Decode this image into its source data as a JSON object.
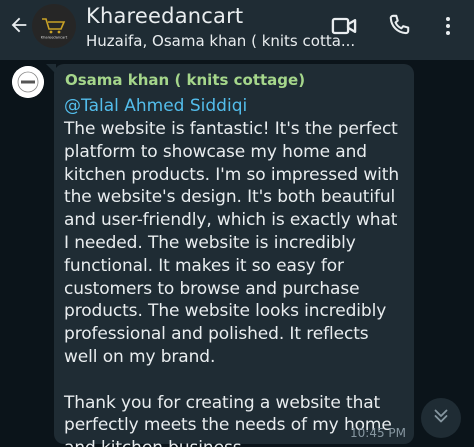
{
  "header": {
    "title": "Khareedancart",
    "subtitle": "Huzaifa, Osama khan ( knits cotta...",
    "logo_text": "Khareedancart",
    "icons": {
      "back": "back-arrow-icon",
      "video": "video-call-icon",
      "phone": "voice-call-icon"
    }
  },
  "message": {
    "sender": "Osama khan ( knits cottage)",
    "mention": "@Talal Ahmed Siddiqi",
    "body": "The website is fantastic! It's the perfect platform to showcase my home and kitchen products. I'm so impressed with the website's design. It's both beautiful and user-friendly, which is exactly what I needed. The website is incredibly functional. It makes it so easy for customers to browse and purchase products. The website looks incredibly professional and polished. It reflects well on my brand.\n\nThank you for creating a website that perfectly meets the needs of my home and kitchen business.",
    "time": "10:45 PM"
  },
  "colors": {
    "header_bg": "#1f2c34",
    "chat_bg": "#0b141a",
    "bubble_bg": "#1f2c34",
    "sender_name": "#a5d68b",
    "mention": "#53bdeb",
    "text": "#e9edef",
    "muted": "#8696a0"
  },
  "scroll_button": {
    "icon": "double-chevron-down-icon"
  }
}
